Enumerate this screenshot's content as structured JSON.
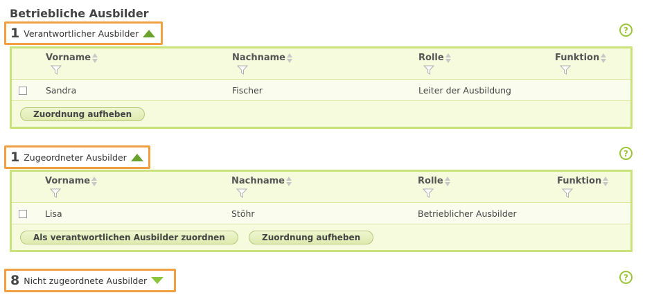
{
  "page": {
    "title": "Betriebliche Ausbilder"
  },
  "columns": {
    "vorname": "Vorname",
    "nachname": "Nachname",
    "rolle": "Rolle",
    "funktion": "Funktion"
  },
  "sections": [
    {
      "count": "1",
      "label": "Verantwortlicher Ausbilder",
      "expanded": true,
      "rows": [
        {
          "vorname": "Sandra",
          "nachname": "Fischer",
          "rolle": "Leiter der Ausbildung",
          "funktion": ""
        }
      ],
      "buttons": [
        "Zuordnung aufheben"
      ]
    },
    {
      "count": "1",
      "label": "Zugeordneter Ausbilder",
      "expanded": true,
      "rows": [
        {
          "vorname": "Lisa",
          "nachname": "Stöhr",
          "rolle": "Betrieblicher Ausbilder",
          "funktion": ""
        }
      ],
      "buttons": [
        "Als verantwortlichen Ausbilder zuordnen",
        "Zuordnung aufheben"
      ]
    },
    {
      "count": "8",
      "label": "Nicht zugeordnete Ausbilder",
      "expanded": false
    }
  ],
  "help": {
    "symbol": "?"
  },
  "colors": {
    "accent_border": "#f0a040",
    "panel_border": "#c9e27a",
    "panel_bg": "#f5fbdc",
    "arrow_green": "#6aa22e"
  }
}
